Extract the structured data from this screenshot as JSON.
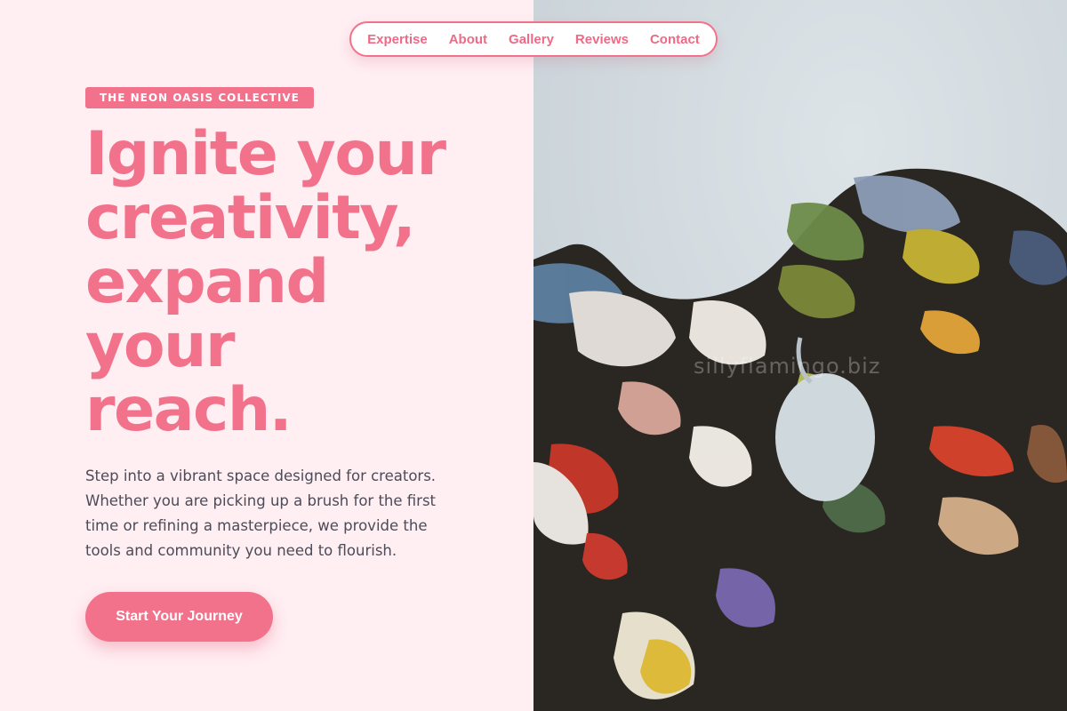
{
  "nav": {
    "items": [
      {
        "label": "Expertise"
      },
      {
        "label": "About"
      },
      {
        "label": "Gallery"
      },
      {
        "label": "Reviews"
      },
      {
        "label": "Contact"
      }
    ]
  },
  "hero": {
    "badge": "THE NEON OASIS COLLECTIVE",
    "headline_lines": [
      "Ignite your",
      "creativity,",
      "expand",
      "your",
      "reach."
    ],
    "body": "Step into a vibrant space designed for creators. Whether you are picking up a brush for the first time or refining a masterpiece, we provide the tools and community you need to flourish.",
    "cta_label": "Start Your Journey"
  },
  "image": {
    "subject": "paint-palette-photo",
    "watermark": "sillyflamingo.biz"
  },
  "colors": {
    "accent": "#f2728c",
    "background": "#ffeef2",
    "text": "#4c4c58",
    "image_wall": "#ccd6dc"
  }
}
